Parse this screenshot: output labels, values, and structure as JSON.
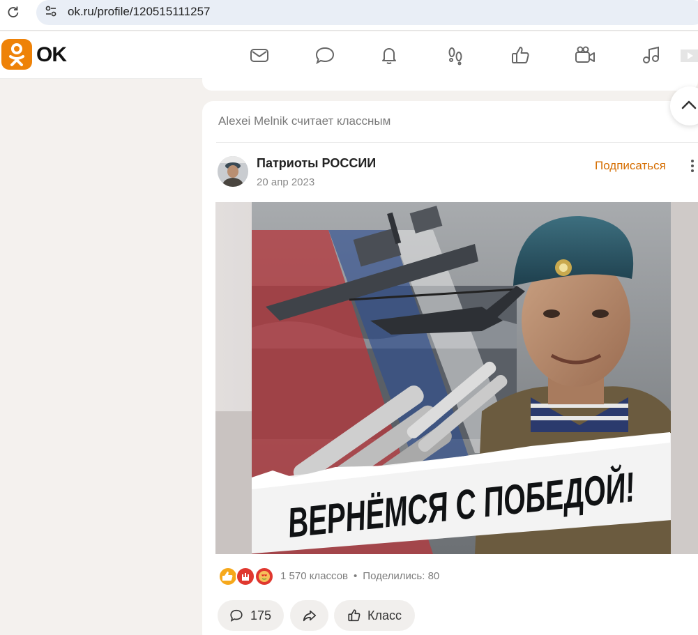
{
  "browser": {
    "url": "ok.ru/profile/120515111257"
  },
  "header": {
    "logo_text": "OK",
    "nav_icons": [
      "mail-icon",
      "discussions-icon",
      "notifications-icon",
      "guests-icon",
      "likes-icon",
      "video-icon",
      "music-icon",
      "games-icon"
    ]
  },
  "post": {
    "liked_by": "Alexei Melnik считает классным",
    "group_name": "Патриоты РОССИИ",
    "date": "20 апр 2023",
    "subscribe_label": "Подписаться",
    "image_caption": "ВЕРНЁМСЯ С ПОБЕДОЙ!",
    "reactions": {
      "classes": "1 570 классов",
      "separator": "•",
      "shares": "Поделились: 80"
    },
    "actions": {
      "comments_count": "175",
      "like_label": "Класс"
    }
  },
  "colors": {
    "brand": "#ee8208",
    "subscribe": "#d56d00"
  }
}
